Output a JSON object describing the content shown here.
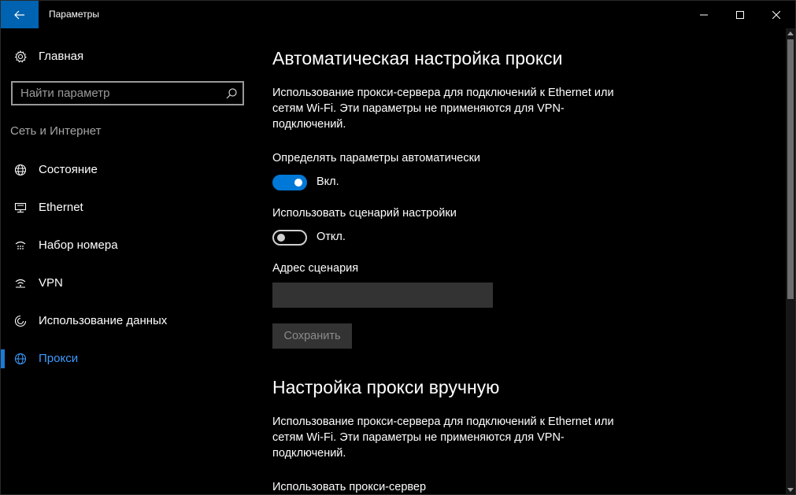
{
  "window": {
    "title": "Параметры"
  },
  "sidebar": {
    "home_label": "Главная",
    "search_placeholder": "Найти параметр",
    "section_label": "Сеть и Интернет",
    "items": [
      {
        "label": "Состояние",
        "icon": "globe-status-icon"
      },
      {
        "label": "Ethernet",
        "icon": "ethernet-icon"
      },
      {
        "label": "Набор номера",
        "icon": "dialup-icon"
      },
      {
        "label": "VPN",
        "icon": "vpn-icon"
      },
      {
        "label": "Использование данных",
        "icon": "data-usage-icon"
      },
      {
        "label": "Прокси",
        "icon": "globe-icon",
        "active": true
      }
    ]
  },
  "auto": {
    "title": "Автоматическая настройка прокси",
    "description": "Использование прокси-сервера для подключений к Ethernet или сетям Wi-Fi. Эти параметры не применяются для VPN-подключений.",
    "detect_label": "Определять параметры автоматически",
    "detect_state": "Вкл.",
    "script_label": "Использовать сценарий настройки",
    "script_state": "Откл.",
    "address_label": "Адрес сценария",
    "address_value": "",
    "save_label": "Сохранить"
  },
  "manual": {
    "title": "Настройка прокси вручную",
    "description": "Использование прокси-сервера для подключений к Ethernet или сетям Wi-Fi. Эти параметры не применяются для VPN-подключений.",
    "use_proxy_label": "Использовать прокси-сервер"
  },
  "colors": {
    "accent": "#0078d7",
    "back_button": "#0063b1",
    "active_nav": "#3c9bff"
  }
}
